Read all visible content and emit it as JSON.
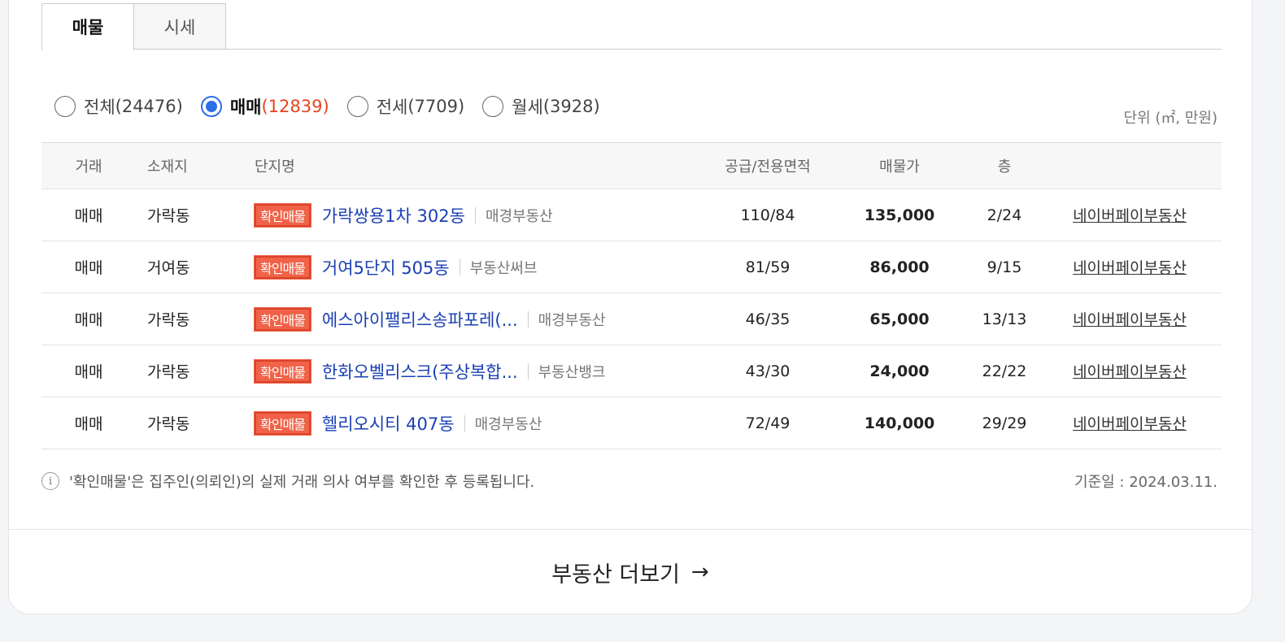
{
  "tabs": [
    {
      "label": "매물",
      "active": true
    },
    {
      "label": "시세",
      "active": false
    }
  ],
  "filters": [
    {
      "label": "전체",
      "count": "(24476)",
      "checked": false
    },
    {
      "label": "매매",
      "count": "(12839)",
      "checked": true
    },
    {
      "label": "전세",
      "count": "(7709)",
      "checked": false
    },
    {
      "label": "월세",
      "count": "(3928)",
      "checked": false
    }
  ],
  "unit_label": "단위 (㎡, 만원)",
  "table": {
    "headers": {
      "type": "거래",
      "location": "소재지",
      "complex": "단지명",
      "area": "공급/전용면적",
      "price": "매물가",
      "floor": "층"
    },
    "badge_label": "확인매물",
    "rows": [
      {
        "type": "매매",
        "location": "가락동",
        "complex": "가락쌍용1차 302동",
        "agency": "매경부동산",
        "area": "110/84",
        "price": "135,000",
        "floor": "2/24",
        "agent": "네이버페이부동산"
      },
      {
        "type": "매매",
        "location": "거여동",
        "complex": "거여5단지 505동",
        "agency": "부동산써브",
        "area": "81/59",
        "price": "86,000",
        "floor": "9/15",
        "agent": "네이버페이부동산"
      },
      {
        "type": "매매",
        "location": "가락동",
        "complex": "에스아이팰리스송파포레(...",
        "agency": "매경부동산",
        "area": "46/35",
        "price": "65,000",
        "floor": "13/13",
        "agent": "네이버페이부동산"
      },
      {
        "type": "매매",
        "location": "가락동",
        "complex": "한화오벨리스크(주상복합...",
        "agency": "부동산뱅크",
        "area": "43/30",
        "price": "24,000",
        "floor": "22/22",
        "agent": "네이버페이부동산"
      },
      {
        "type": "매매",
        "location": "가락동",
        "complex": "헬리오시티 407동",
        "agency": "매경부동산",
        "area": "72/49",
        "price": "140,000",
        "floor": "29/29",
        "agent": "네이버페이부동산"
      }
    ]
  },
  "note": "'확인매물'은 집주인(의뢰인)의 실제 거래 의사 여부를 확인한 후 등록됩니다.",
  "base_date": "기준일 : 2024.03.11.",
  "more_button": {
    "label": "부동산 더보기",
    "arrow": "→"
  },
  "icons": {
    "info": "info-icon",
    "arrow": "arrow-right-icon"
  },
  "colors": {
    "accent": "#2c6ce8",
    "count_highlight": "#e5451f",
    "badge": "#f06349",
    "link": "#1a3fb4"
  }
}
